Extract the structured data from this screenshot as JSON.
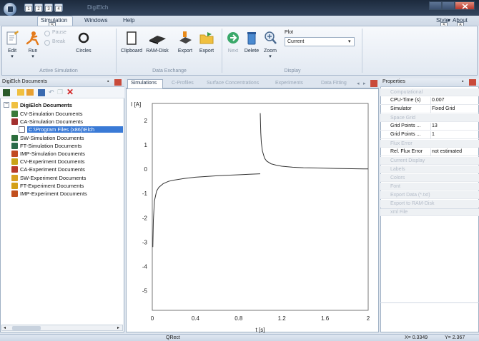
{
  "window": {
    "title": "DigiElch"
  },
  "quick_access": {
    "keytips": [
      "1",
      "2",
      "3",
      "4"
    ]
  },
  "ribbon_tabs": [
    {
      "label": "Simulation",
      "keytip": "S",
      "active": true
    },
    {
      "label": "Windows"
    },
    {
      "label": "Help"
    }
  ],
  "ribbon_right": {
    "style": "Style",
    "about": "About",
    "style_keytip": "5",
    "about_keytip": "6"
  },
  "groups": {
    "active_simulation": {
      "label": "Active Simulation",
      "edit": "Edit",
      "run": "Run",
      "pause": "Pause",
      "break": "Break",
      "circles": "Circles"
    },
    "data_exchange": {
      "label": "Data Exchange",
      "clipboard": "Clipboard",
      "ram_disk": "RAM-Disk",
      "export1": "Export",
      "export2": "Export"
    },
    "display": {
      "label": "Display",
      "next": "Next",
      "delete": "Delete",
      "zoom": "Zoom",
      "plot_label": "Plot",
      "plot_value": "Current"
    }
  },
  "left_panel": {
    "title": "DigiElch Documents",
    "root": "DigiElch Documents",
    "items": [
      {
        "label": "CV-Simulation Documents",
        "color": "#3a7a3a"
      },
      {
        "label": "CA-Simulation Documents",
        "color": "#a33030"
      },
      {
        "label": "C:\\Program Files (x86)\\Elch",
        "color": "#ffffff",
        "selected": true
      },
      {
        "label": "SW-Simulation Documents",
        "color": "#2c6e3c"
      },
      {
        "label": "FT-Simulation Documents",
        "color": "#2a6a4a"
      },
      {
        "label": "IMP-Simulation Documents",
        "color": "#c24a20"
      },
      {
        "label": "CV-Experiment Documents",
        "color": "#c9a418"
      },
      {
        "label": "CA-Experiment Documents",
        "color": "#b83a2a"
      },
      {
        "label": "SW-Experiment Documents",
        "color": "#d9a020"
      },
      {
        "label": "FT-Experiment Documents",
        "color": "#d4a016"
      },
      {
        "label": "IMP-Experiment Documents",
        "color": "#c2501e"
      }
    ]
  },
  "doc_tabs": [
    {
      "label": "Simulations",
      "active": true
    },
    {
      "label": "C-Profiles"
    },
    {
      "label": "Surface Concentrations"
    },
    {
      "label": "Experiments"
    },
    {
      "label": "Data Fitting"
    }
  ],
  "chart_data": {
    "type": "line",
    "ylabel": "I [A]",
    "xlabel": "t [s]",
    "xlim": [
      0,
      2
    ],
    "ylim": [
      -5.8,
      2.7
    ],
    "x_ticks": [
      "0",
      "0.4",
      "0.8",
      "1.2",
      "1.6",
      "2"
    ],
    "y_ticks": [
      "2",
      "1",
      "0",
      "-1",
      "-2",
      "-3",
      "-4",
      "-5"
    ],
    "series": [
      {
        "x": [
          0.005,
          0.01,
          0.02,
          0.04,
          0.06,
          0.1,
          0.15,
          0.2,
          0.3,
          0.4,
          0.5,
          0.6,
          0.7,
          0.8,
          0.9,
          1.0
        ],
        "y": [
          -3.2,
          -2.1,
          -1.3,
          -0.9,
          -0.75,
          -0.6,
          -0.5,
          -0.45,
          -0.38,
          -0.33,
          -0.3,
          -0.27,
          -0.25,
          -0.23,
          -0.21,
          -0.19
        ]
      },
      {
        "x": [
          1.0,
          1.005,
          1.01,
          1.02,
          1.04,
          1.06,
          1.1,
          1.15,
          1.2,
          1.3,
          1.4,
          1.5,
          1.6,
          1.7,
          1.8,
          1.9,
          2.0
        ],
        "y": [
          2.3,
          1.5,
          1.1,
          0.75,
          0.45,
          0.33,
          0.22,
          0.16,
          0.12,
          0.08,
          0.06,
          0.05,
          0.04,
          0.03,
          0.02,
          0.015,
          0.01
        ]
      }
    ]
  },
  "properties": {
    "title": "Properties",
    "rows": [
      {
        "type": "cat",
        "label": "Computational"
      },
      {
        "type": "prop",
        "name": "CPU-Time (s)",
        "value": "0.007"
      },
      {
        "type": "prop",
        "name": "Simulator",
        "value": "Fixed Grid"
      },
      {
        "type": "cat",
        "label": "Space Grid"
      },
      {
        "type": "prop",
        "name": "Grid Points ...",
        "value": "13"
      },
      {
        "type": "prop",
        "name": "Grid Points ...",
        "value": "1"
      },
      {
        "type": "cat",
        "label": "Flux Error"
      },
      {
        "type": "prop",
        "name": "Rel. Flux Error",
        "value": "not estimated"
      },
      {
        "type": "cat",
        "label": "Current Display"
      },
      {
        "type": "cat",
        "label": "Labels"
      },
      {
        "type": "cat",
        "label": "Colors"
      },
      {
        "type": "cat",
        "label": "Font"
      },
      {
        "type": "cat",
        "label": "Export Data (*.txt)"
      },
      {
        "type": "cat",
        "label": "Export to RAM-Disk"
      },
      {
        "type": "cat",
        "label": "xml File"
      }
    ]
  },
  "status": {
    "center": "QRect",
    "x": "X= 0.3349",
    "y": "Y= 2.367"
  }
}
